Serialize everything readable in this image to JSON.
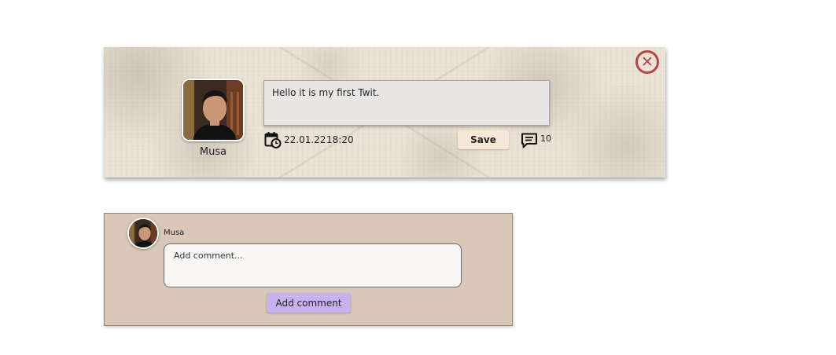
{
  "tweet": {
    "close_icon": "close-circle-icon",
    "user": {
      "name": "Musa",
      "avatar_icon": "user-photo"
    },
    "text": "Hello it is my first Twit.",
    "date": "22.01.22",
    "time": "18:20",
    "date_icon": "calendar-clock-icon",
    "save_label": "Save",
    "comment_icon": "comment-icon",
    "comment_count": "10"
  },
  "comment_box": {
    "user": {
      "name": "Musa",
      "avatar_icon": "user-photo"
    },
    "placeholder": "Add comment...",
    "add_label": "Add comment"
  },
  "colors": {
    "close": "#b0484a",
    "save_button": "#f7e7d6",
    "add_button": "#c7b1ee",
    "comment_card": "#d9c8b7"
  }
}
